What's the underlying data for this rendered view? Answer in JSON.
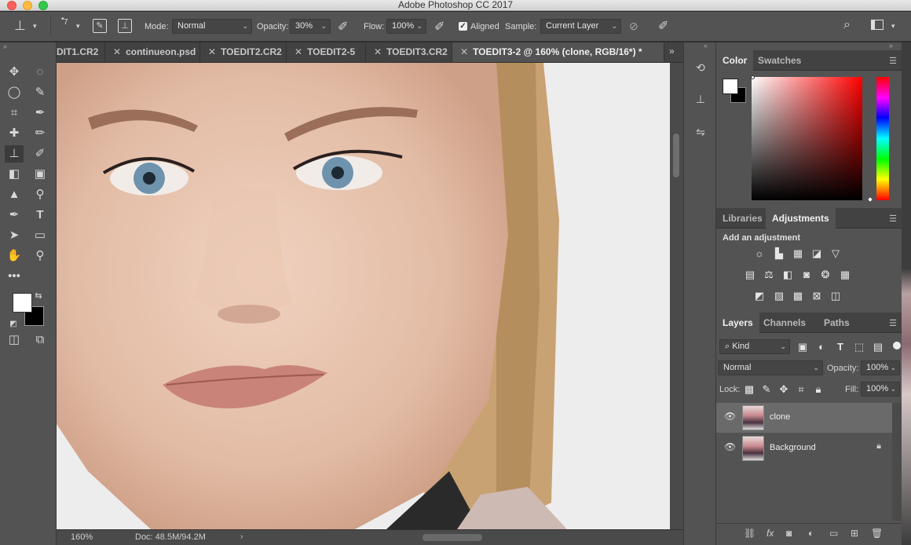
{
  "window": {
    "title": "Adobe Photoshop CC 2017"
  },
  "options": {
    "brush_size": "7",
    "mode_label": "Mode:",
    "mode_value": "Normal",
    "opacity_label": "Opacity:",
    "opacity_value": "30%",
    "flow_label": "Flow:",
    "flow_value": "100%",
    "aligned_label": "Aligned",
    "aligned_checked": true,
    "sample_label": "Sample:",
    "sample_value": "Current Layer"
  },
  "tabs": [
    {
      "label": "DIT1.CR2",
      "active": false
    },
    {
      "label": "continueon.psd",
      "active": false
    },
    {
      "label": "TOEDIT2.CR2",
      "active": false
    },
    {
      "label": "TOEDIT2-5",
      "active": false
    },
    {
      "label": "TOEDIT3.CR2",
      "active": false
    },
    {
      "label": "TOEDIT3-2 @ 160% (clone, RGB/16*) *",
      "active": true
    }
  ],
  "status": {
    "zoom": "160%",
    "doc": "Doc: 48.5M/94.2M"
  },
  "color_panel": {
    "tabs": [
      "Color",
      "Swatches"
    ],
    "active": "Color",
    "foreground": "#ffffff",
    "background": "#000000"
  },
  "adjust_panel": {
    "tabs": [
      "Libraries",
      "Adjustments"
    ],
    "active": "Adjustments",
    "heading": "Add an adjustment"
  },
  "layers_panel": {
    "tabs": [
      "Layers",
      "Channels",
      "Paths"
    ],
    "active": "Layers",
    "filter": "Kind",
    "blend_mode": "Normal",
    "opacity_label": "Opacity:",
    "opacity": "100%",
    "lock_label": "Lock:",
    "fill_label": "Fill:",
    "fill": "100%",
    "layers": [
      {
        "name": "clone",
        "visible": true,
        "selected": true,
        "locked": false
      },
      {
        "name": "Background",
        "visible": true,
        "selected": false,
        "locked": true
      }
    ]
  }
}
